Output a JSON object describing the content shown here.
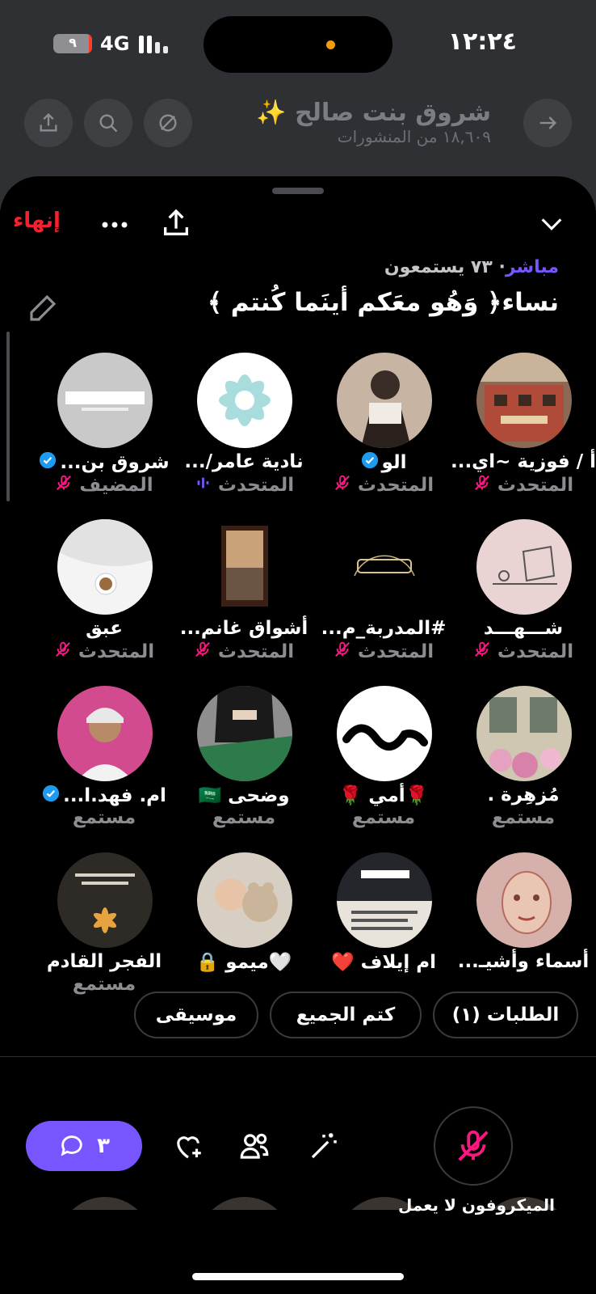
{
  "status_bar": {
    "time": "١٢:٢٤",
    "network": "4G",
    "battery_text": "٩",
    "battery_level": 0.09
  },
  "background_profile": {
    "name": "شروق بنت صالح ✨",
    "posts": "١٨,٦٠٩ من المنشورات"
  },
  "space": {
    "end_label": "إنهاء",
    "live_label": "مباشر",
    "listeners": "٧٣ يستمعون",
    "title": "نساء﴿ وَهُو معَكم أينَما كُنتم ﴾"
  },
  "participants": [
    {
      "name": "أ / فوزية ~اي...",
      "role": "المتحدث",
      "verified": false,
      "mic": "off",
      "avatar": "photo-building"
    },
    {
      "name": "الو",
      "role": "المتحدث",
      "verified": true,
      "mic": "off",
      "avatar": "photo-girl-drawing"
    },
    {
      "name": "نادية عامر/...",
      "role": "المتحدث",
      "verified": false,
      "mic": "speaking",
      "avatar": "logo-flower"
    },
    {
      "name": "شروق بن...",
      "role": "المضيف",
      "verified": true,
      "mic": "off",
      "avatar": "logo-text"
    },
    {
      "name": "شـــهـــد",
      "role": "المتحدث",
      "verified": false,
      "mic": "off",
      "avatar": "sketch-laptop"
    },
    {
      "name": "#المدربة_م...",
      "role": "المتحدث",
      "verified": false,
      "mic": "off",
      "avatar": "logo-calligraphy"
    },
    {
      "name": "أشواق غانم...",
      "role": "المتحدث",
      "verified": false,
      "mic": "off",
      "avatar": "photo-window"
    },
    {
      "name": "عبق",
      "role": "المتحدث",
      "verified": false,
      "mic": "off",
      "avatar": "photo-coffee"
    },
    {
      "name": "مُزهِرة .",
      "role": "مستمع",
      "verified": false,
      "mic": "none",
      "avatar": "photo-flowers"
    },
    {
      "name": "🌹أمي 🌹",
      "role": "مستمع",
      "verified": false,
      "mic": "none",
      "avatar": "logo-maryam"
    },
    {
      "name": "وضحى 🇸🇦",
      "role": "مستمع",
      "verified": false,
      "mic": "none",
      "avatar": "photo-flag"
    },
    {
      "name": "ام. فهد.ا...",
      "role": "مستمع",
      "verified": true,
      "mic": "none",
      "avatar": "photo-man"
    },
    {
      "name": "أسماء وأشيـ...",
      "role": "",
      "verified": false,
      "mic": "none",
      "avatar": "drawing-face"
    },
    {
      "name": "ام إيلاف ❤️",
      "role": "",
      "verified": false,
      "mic": "none",
      "avatar": "photo-quote"
    },
    {
      "name": "🤍ميمو 🔒",
      "role": "",
      "verified": false,
      "mic": "none",
      "avatar": "photo-baby"
    },
    {
      "name": "الفجر القادم",
      "role": "مستمع",
      "verified": false,
      "mic": "none",
      "avatar": "photo-dark-flower"
    }
  ],
  "chips": {
    "requests": "الطلبات (١)",
    "mute_all": "كتم الجميع",
    "music": "موسيقى"
  },
  "bottom_bar": {
    "reply_count": "٣",
    "mic_status": "الميكروفون لا يعمل"
  },
  "colors": {
    "accent": "#7856ff",
    "danger": "#f4212e",
    "mic_off_pink": "#f91880",
    "verified_blue": "#1d9bf0",
    "muted_text": "#8b8d91"
  }
}
